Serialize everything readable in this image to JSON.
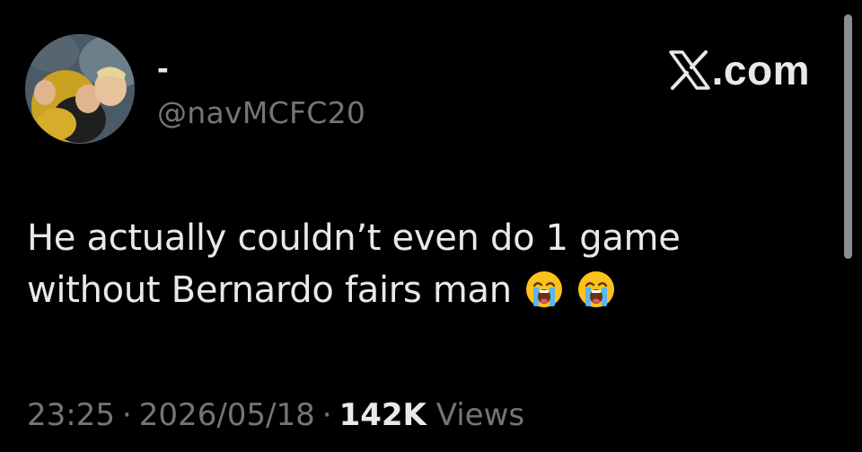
{
  "profile": {
    "display_name": "-",
    "handle": "@navMCFC20"
  },
  "brand": {
    "text": ".com",
    "logo_icon": "x-logo-icon"
  },
  "tweet": {
    "text": "He actually couldn’t even do 1 game without Bernardo fairs man",
    "emojis": [
      "loudly-crying-face-icon",
      "loudly-crying-face-icon"
    ]
  },
  "meta": {
    "time": "23:25",
    "separator": "·",
    "date": "2026/05/18",
    "views_count": "142K",
    "views_label": "Views"
  },
  "colors": {
    "background": "#000000",
    "primary_text": "#e7e9ea",
    "secondary_text": "#71767b",
    "scrollbar": "#8b8f93"
  }
}
